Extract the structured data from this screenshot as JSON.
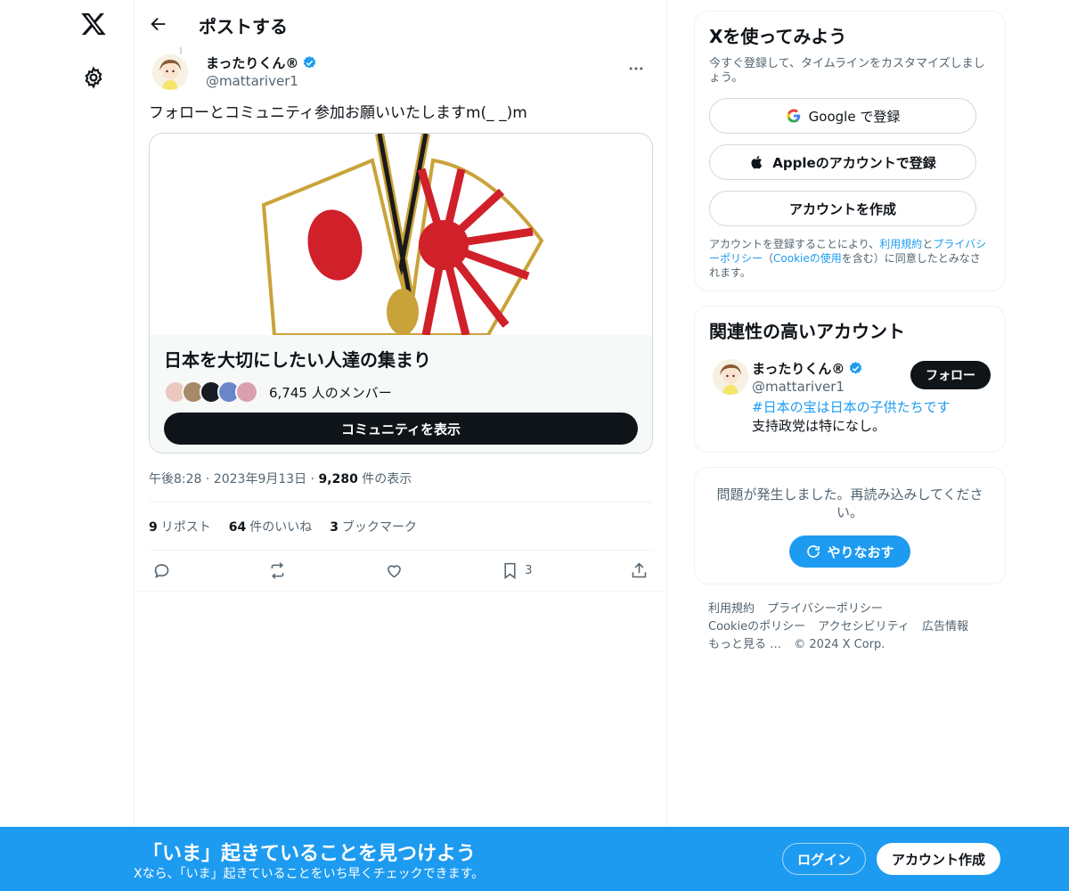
{
  "header": {
    "title": "ポストする"
  },
  "post": {
    "author_name": "まったりくん®",
    "author_handle": "@mattariver1",
    "text": "フォローとコミュニティ参加お願いいたしますm(_ _)m",
    "card": {
      "title": "日本を大切にしたい人達の集まり",
      "members": "6,745 人のメンバー",
      "button": "コミュニティを表示"
    },
    "time": "午後8:28",
    "date": "2023年9月13日",
    "views_count": "9,280",
    "views_label": "件の表示",
    "reposts_count": "9",
    "reposts_label": "リポスト",
    "likes_count": "64",
    "likes_label": "件のいいね",
    "bookmarks_count": "3",
    "bookmarks_label": "ブックマーク",
    "bookmark_action_count": "3"
  },
  "signup": {
    "title": "Xを使ってみよう",
    "subtitle": "今すぐ登録して、タイムラインをカスタマイズしましょう。",
    "google": "Google で登録",
    "apple": "Appleのアカウントで登録",
    "create": "アカウントを作成",
    "terms_pre": "アカウントを登録することにより、",
    "terms_link1": "利用規約",
    "terms_mid": "と",
    "terms_link2": "プライバシーポリシー",
    "terms_paren_open": "（",
    "terms_link3": "Cookieの使用",
    "terms_post": "を含む）に同意したとみなされます。"
  },
  "related": {
    "title": "関連性の高いアカウント",
    "name": "まったりくん®",
    "handle": "@mattariver1",
    "follow": "フォロー",
    "bio_tag": "#日本の宝は日本の子供たちです",
    "bio_rest": " 支持政党は特になし。"
  },
  "error_box": {
    "message": "問題が発生しました。再読み込みしてください。",
    "retry": "やりなおす"
  },
  "footer": {
    "links": [
      "利用規約",
      "プライバシーポリシー",
      "Cookieのポリシー",
      "アクセシビリティ",
      "広告情報",
      "もっと見る …"
    ],
    "copyright": "© 2024 X Corp."
  },
  "bottom_bar": {
    "title": "「いま」起きていることを見つけよう",
    "subtitle": "Xなら、「いま」起きていることをいち早くチェックできます。",
    "login": "ログイン",
    "create": "アカウント作成"
  },
  "colors": {
    "accent": "#1d9bf0",
    "text": "#0f1419",
    "muted": "#536471",
    "red": "#d0202a"
  },
  "icons": [
    "x-logo-icon",
    "gear-icon",
    "back-arrow-icon",
    "verified-icon",
    "more-icon",
    "reply-icon",
    "repost-icon",
    "like-icon",
    "bookmark-icon",
    "share-icon",
    "google-icon",
    "apple-icon",
    "refresh-icon"
  ]
}
